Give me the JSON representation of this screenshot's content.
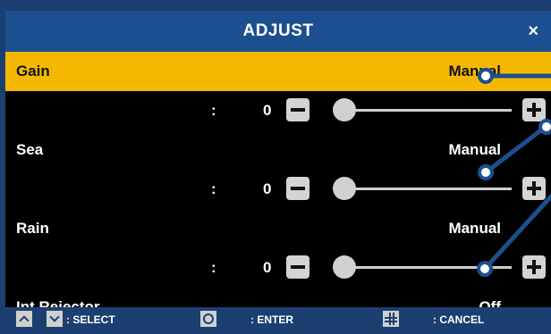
{
  "dialog": {
    "title": "ADJUST",
    "close_label": "×"
  },
  "rows": [
    {
      "name": "Gain",
      "mode": "Manual",
      "colon": ":",
      "value": "0",
      "level": 0.0,
      "selected": true
    },
    {
      "name": "Sea",
      "mode": "Manual",
      "colon": ":",
      "value": "0",
      "level": 0.0,
      "selected": false
    },
    {
      "name": "Rain",
      "mode": "Manual",
      "colon": ":",
      "value": "0",
      "level": 0.0,
      "selected": false
    },
    {
      "name": "Int Rejector",
      "mode": "Off",
      "selected": false
    }
  ],
  "footer": {
    "select_label": ": SELECT",
    "enter_label": ": ENTER",
    "cancel_label": ": CANCEL"
  },
  "colors": {
    "title_bar": "#1c4f8f",
    "selected_row": "#f5b800",
    "panel": "#000000",
    "callout": "#1c4f8f"
  }
}
